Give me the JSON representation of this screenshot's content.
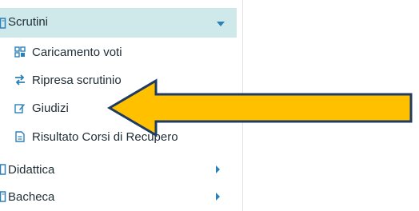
{
  "menu": {
    "header": {
      "label": "Scrutini",
      "icon": "book-icon"
    },
    "subitems": [
      {
        "label": "Caricamento voti",
        "icon": "grid-icon"
      },
      {
        "label": "Ripresa scrutinio",
        "icon": "swap-arrows-icon"
      },
      {
        "label": "Giudizi",
        "icon": "edit-icon"
      },
      {
        "label": "Risultato Corsi di Recupero",
        "icon": "document-icon"
      }
    ],
    "items": [
      {
        "label": "Didattica",
        "icon": "book-icon"
      },
      {
        "label": "Bacheca",
        "icon": "book-icon"
      }
    ]
  },
  "colors": {
    "header_bg": "#cfe8ea",
    "accent": "#2b80b8",
    "annotation_arrow_fill": "#ffc000",
    "annotation_arrow_stroke": "#1f3b63"
  }
}
